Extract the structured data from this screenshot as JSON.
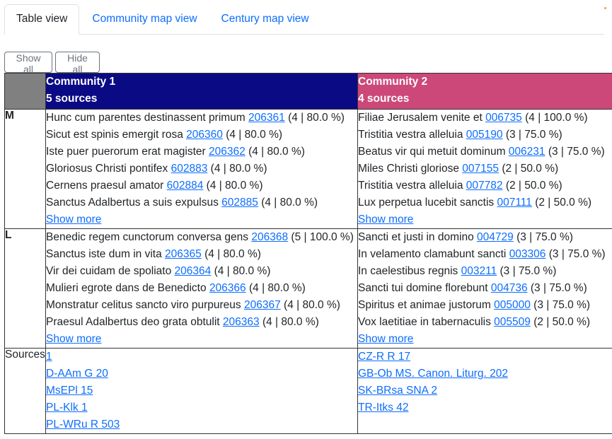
{
  "tabs": [
    {
      "label": "Table view"
    },
    {
      "label": "Community map view"
    },
    {
      "label": "Century map view"
    }
  ],
  "buttons": {
    "show_all": "Show all",
    "hide_all": "Hide all"
  },
  "colors": {
    "community1": "#0b0a85",
    "community2": "#cc4878",
    "corner": "#808080",
    "link": "#0d6efd"
  },
  "communities": [
    {
      "name": "Community 1",
      "sources": "5 sources"
    },
    {
      "name": "Community 2",
      "sources": "4 sources"
    }
  ],
  "rows": [
    {
      "label": "M",
      "cells": [
        {
          "items": [
            {
              "text": "Hunc cum parentes destinassent primum",
              "id": "206361",
              "stat": "(4 | 80.0 %)"
            },
            {
              "text": "Sicut est spinis emergit rosa",
              "id": "206360",
              "stat": "(4 | 80.0 %)"
            },
            {
              "text": "Iste puer puerorum erat magister",
              "id": "206362",
              "stat": "(4 | 80.0 %)"
            },
            {
              "text": "Gloriosus Christi pontifex",
              "id": "602883",
              "stat": "(4 | 80.0 %)"
            },
            {
              "text": "Cernens praesul amator",
              "id": "602884",
              "stat": "(4 | 80.0 %)"
            },
            {
              "text": "Sanctus Adalbertus a suis expulsus",
              "id": "602885",
              "stat": "(4 | 80.0 %)"
            }
          ],
          "more": "Show more"
        },
        {
          "items": [
            {
              "text": "Filiae Jerusalem venite et",
              "id": "006735",
              "stat": "(4 | 100.0 %)"
            },
            {
              "text": "Tristitia vestra alleluia",
              "id": "005190",
              "stat": "(3 | 75.0 %)"
            },
            {
              "text": "Beatus vir qui metuit dominum",
              "id": "006231",
              "stat": "(3 | 75.0 %)"
            },
            {
              "text": "Miles Christi gloriose",
              "id": "007155",
              "stat": "(2 | 50.0 %)"
            },
            {
              "text": "Tristitia vestra alleluia",
              "id": "007782",
              "stat": "(2 | 50.0 %)"
            },
            {
              "text": "Lux perpetua lucebit sanctis",
              "id": "007111",
              "stat": "(2 | 50.0 %)"
            }
          ],
          "more": "Show more"
        }
      ]
    },
    {
      "label": "L",
      "cells": [
        {
          "items": [
            {
              "text": "Benedic regem cunctorum conversa gens",
              "id": "206368",
              "stat": "(5 | 100.0 %)"
            },
            {
              "text": "Sanctus iste dum in vita",
              "id": "206365",
              "stat": "(4 | 80.0 %)"
            },
            {
              "text": "Vir dei cuidam de spoliato",
              "id": "206364",
              "stat": "(4 | 80.0 %)"
            },
            {
              "text": "Mulieri egrote dans de Benedicto",
              "id": "206366",
              "stat": "(4 | 80.0 %)"
            },
            {
              "text": "Monstratur celitus sancto viro purpureus",
              "id": "206367",
              "stat": "(4 | 80.0 %)"
            },
            {
              "text": "Praesul Adalbertus deo grata obtulit",
              "id": "206363",
              "stat": "(4 | 80.0 %)"
            }
          ],
          "more": "Show more"
        },
        {
          "items": [
            {
              "text": "Sancti et justi in domino",
              "id": "004729",
              "stat": "(3 | 75.0 %)"
            },
            {
              "text": "In velamento clamabunt sancti",
              "id": "003306",
              "stat": "(3 | 75.0 %)"
            },
            {
              "text": "In caelestibus regnis",
              "id": "003211",
              "stat": "(3 | 75.0 %)"
            },
            {
              "text": "Sancti tui domine florebunt",
              "id": "004736",
              "stat": "(3 | 75.0 %)"
            },
            {
              "text": "Spiritus et animae justorum",
              "id": "005000",
              "stat": "(3 | 75.0 %)"
            },
            {
              "text": "Vox laetitiae in tabernaculis",
              "id": "005509",
              "stat": "(2 | 50.0 %)"
            }
          ],
          "more": "Show more"
        }
      ]
    }
  ],
  "sources_row": {
    "label": "Sources",
    "cells": [
      [
        "1",
        "D-AAm G 20",
        "MsEPl 15",
        "PL-Klk 1",
        "PL-WRu R 503"
      ],
      [
        "CZ-R R 17",
        "GB-Ob MS. Canon. Liturg. 202",
        "SK-BRsa SNA 2",
        "TR-Itks 42"
      ]
    ]
  }
}
